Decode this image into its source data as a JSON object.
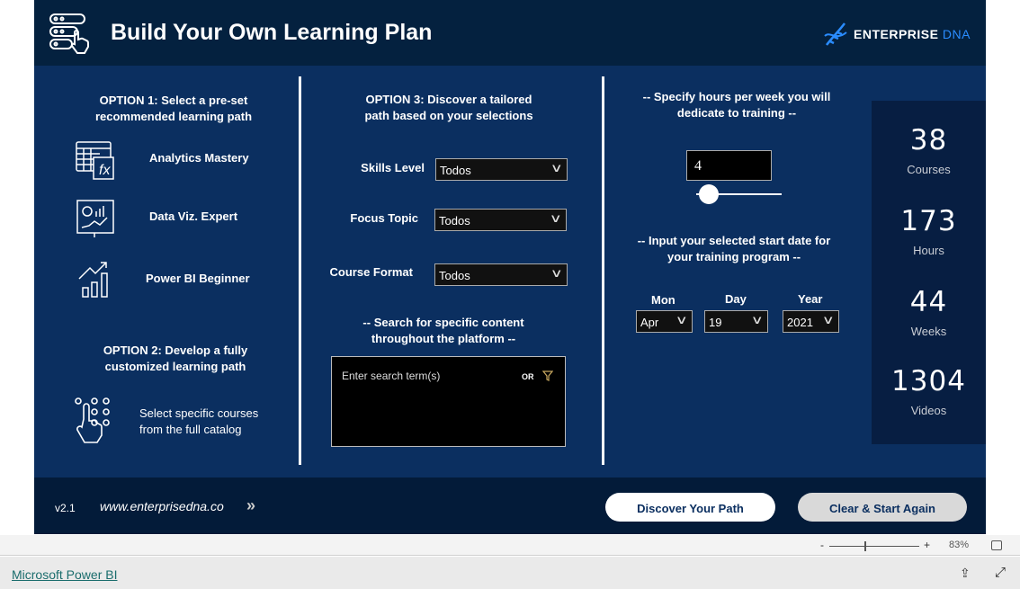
{
  "header": {
    "title": "Build Your Own Learning Plan",
    "logo_main": "ENTERPRISE",
    "logo_accent": "DNA"
  },
  "option1": {
    "title_line1": "OPTION 1: Select a pre-set",
    "title_line2": "recommended learning path",
    "paths": [
      {
        "label": "Analytics Mastery",
        "icon": "spreadsheet-fx-icon"
      },
      {
        "label": "Data Viz. Expert",
        "icon": "presentation-chart-icon"
      },
      {
        "label": "Power BI Beginner",
        "icon": "growth-chart-icon"
      }
    ]
  },
  "option2": {
    "title_line1": "OPTION 2: Develop a fully",
    "title_line2": "customized learning path",
    "text_line1": "Select specific courses",
    "text_line2": "from the full catalog"
  },
  "option3": {
    "title_line1": "OPTION 3: Discover a tailored",
    "title_line2": "path based on your selections",
    "filters": [
      {
        "label": "Skills Level",
        "value": "Todos"
      },
      {
        "label": "Focus Topic",
        "value": "Todos"
      },
      {
        "label": "Course Format",
        "value": "Todos"
      }
    ],
    "search_title_line1": "-- Search for specific content",
    "search_title_line2": "throughout the platform  --",
    "search_placeholder": "Enter search term(s)",
    "search_mode": "OR"
  },
  "hours": {
    "title_line1": "-- Specify hours per week you will",
    "title_line2": "dedicate to training --",
    "value": "4",
    "slider_fraction": 0.15
  },
  "start_date": {
    "title_line1": "-- Input your selected start date for",
    "title_line2": "your training program --",
    "month_label": "Mon",
    "month": "Apr",
    "day_label": "Day",
    "day": "19",
    "year_label": "Year",
    "year": "2021"
  },
  "stats": [
    {
      "value": "38",
      "label": "Courses"
    },
    {
      "value": "173",
      "label": "Hours"
    },
    {
      "value": "44",
      "label": "Weeks"
    },
    {
      "value": "1304",
      "label": "Videos"
    }
  ],
  "footer": {
    "version": "v2.1",
    "url": "www.enterprisedna.co",
    "discover_button": "Discover Your Path",
    "clear_button": "Clear & Start Again"
  },
  "statusbar": {
    "zoom_minus": "-",
    "zoom_plus": "+",
    "zoom": "83%"
  },
  "bottombar": {
    "link": "Microsoft Power BI"
  },
  "colors": {
    "background": "#0b2f60",
    "header": "#04213f",
    "accent": "#2a8cff",
    "link": "#1b6d6d"
  }
}
